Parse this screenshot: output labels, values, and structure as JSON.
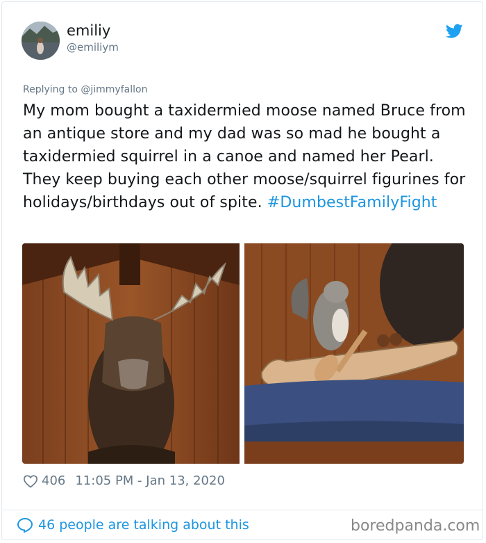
{
  "tweet": {
    "display_name": "emiliy",
    "handle": "@emiliym",
    "reply_to": "Replying to @jimmyfallon",
    "text": "My mom bought a taxidermied moose named Bruce from an antique store and my dad was so mad he bought a taxidermied squirrel in a canoe and named her Pearl. They keep buying each other moose/squirrel figurines for holidays/birthdays out of spite.",
    "hashtag": "#DumbestFamilyFight",
    "likes": "406",
    "timestamp": "11:05 PM - Jan 13, 2020",
    "talking": "46 people are talking about this"
  },
  "icons": {
    "brand": "twitter-bird-icon",
    "like": "heart-icon",
    "reply": "speech-bubble-icon"
  },
  "colors": {
    "link": "#1b95e0",
    "muted": "#657786",
    "text": "#14171a",
    "border": "#e1e8ed"
  },
  "watermark": "boredpanda.com"
}
